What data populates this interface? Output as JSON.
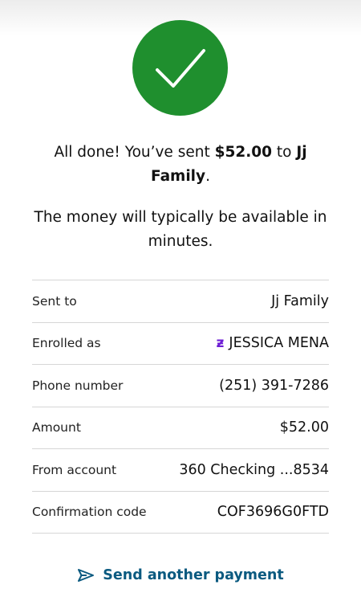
{
  "confirmation": {
    "line1_prefix": "All done! You’ve sent ",
    "amount": "$52.00",
    "line1_middle": " to ",
    "recipient": "Jj Family",
    "line1_suffix": ".",
    "line2": "The money will typically be available in minutes."
  },
  "details": [
    {
      "label": "Sent to",
      "value": "Jj Family"
    },
    {
      "label": "Enrolled as",
      "value": "JESSICA MENA",
      "icon": "zelle-icon"
    },
    {
      "label": "Phone number",
      "value": "(251) 391-7286"
    },
    {
      "label": "Amount",
      "value": "$52.00"
    },
    {
      "label": "From account",
      "value": "360 Checking ...8534"
    },
    {
      "label": "Confirmation code",
      "value": "COF3696G0FTD"
    }
  ],
  "actions": {
    "send_another_label": "Send another payment",
    "send_icon": "send-icon"
  },
  "colors": {
    "success": "#1f8f2e",
    "link": "#0b5a80",
    "zelle": "#6d1ed4"
  }
}
